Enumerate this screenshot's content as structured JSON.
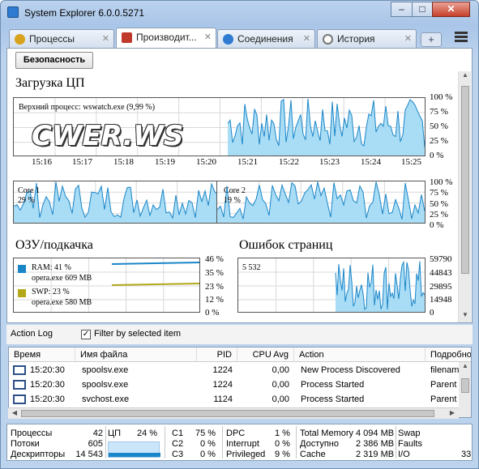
{
  "window": {
    "title": "System Explorer 6.0.0.5271",
    "minimize": "–",
    "maximize": "□",
    "close": "✕"
  },
  "tabs": [
    {
      "label": "Процессы",
      "icon": "gear-icon",
      "icon_color": "#d9a21c"
    },
    {
      "label": "Производит...",
      "icon": "monitor-icon",
      "icon_color": "#c0392b"
    },
    {
      "label": "Соединения",
      "icon": "globe-icon",
      "icon_color": "#2f7bd1"
    },
    {
      "label": "История",
      "icon": "clock-icon",
      "icon_color": "#777777"
    }
  ],
  "tab_close": "✕",
  "new_tab": "+",
  "security_button": "Безопасность",
  "cpu": {
    "heading": "Загрузка ЦП",
    "top_process": "Верхний процесс: wswatch.exe (9,99 %)",
    "yticks": [
      "100 %",
      "75 %",
      "50 %",
      "25 %",
      "0 %"
    ],
    "xticks": [
      "15:16",
      "15:17",
      "15:18",
      "15:19",
      "15:20",
      "15:21",
      "15:22",
      "15:23",
      "15:24",
      "15:25"
    ],
    "core1": "Core 1",
    "core1_val": "29 %",
    "core2": "Core 2",
    "core2_val": "19 %"
  },
  "watermark": "CWER.WS",
  "ram": {
    "heading": "ОЗУ/подкачка",
    "ram_label": "RAM: 41 %",
    "ram_proc": "opera.exe 609 MB",
    "swp_label": "SWP: 23 %",
    "swp_proc": "opera.exe 580 MB",
    "yticks": [
      "46 %",
      "35 %",
      "23 %",
      "12 %",
      "0 %"
    ],
    "ram_color": "#1a86c8",
    "swp_color": "#b2a81a"
  },
  "faults": {
    "heading": "Ошибок страниц",
    "value": "5 532",
    "yticks": [
      "59790",
      "44843",
      "29895",
      "14948",
      "0"
    ]
  },
  "series_color": "#1a86c8",
  "action_log": {
    "label": "Action Log",
    "filter_label": "Filter by selected item",
    "filter_checked": "✓"
  },
  "table": {
    "headers": [
      "Время",
      "Имя файла",
      "PID",
      "CPU Avg",
      "Action",
      "Подробно"
    ],
    "rows": [
      [
        "15:20:30",
        "spoolsv.exe",
        "1224",
        "0,00",
        "New Process Discovered",
        "filenam"
      ],
      [
        "15:20:30",
        "spoolsv.exe",
        "1224",
        "0,00",
        "Process Started",
        "Parent"
      ],
      [
        "15:20:30",
        "svchost.exe",
        "1124",
        "0,00",
        "Process Started",
        "Parent"
      ]
    ]
  },
  "status": {
    "processes_label": "Процессы",
    "processes": "42",
    "threads_label": "Потоки",
    "threads": "605",
    "handles_label": "Дескрипторы",
    "handles": "14 543",
    "cpu_label": "ЦП",
    "cpu": "24 %",
    "c1_label": "C1",
    "c1": "75 %",
    "c2_label": "C2",
    "c2": "0 %",
    "c3_label": "C3",
    "c3": "0 %",
    "dpc_label": "DPC",
    "dpc": "1 %",
    "interrupt_label": "Interrupt",
    "interrupt": "0 %",
    "privileged_label": "Privileged",
    "privileged": "9 %",
    "total_mem_label": "Total Memory",
    "total_mem": "4 094 MB",
    "avail_label": "Доступно",
    "avail": "2 386 MB",
    "cache_label": "Cache",
    "cache": "2 319 MB",
    "swap_label": "Swap",
    "faults_label": "Faults",
    "io_label": "I/O",
    "io": "33"
  }
}
